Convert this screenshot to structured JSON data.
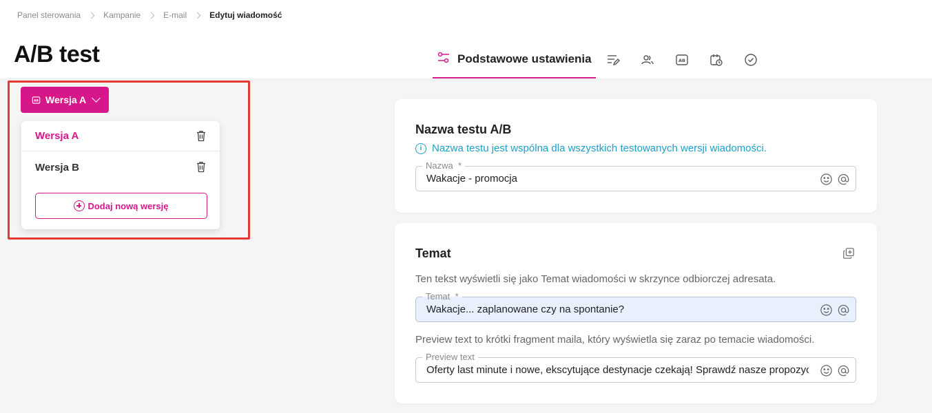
{
  "breadcrumb": {
    "items": [
      "Panel sterowania",
      "Kampanie",
      "E-mail"
    ],
    "current": "Edytuj wiadomość"
  },
  "page_title": "A/B test",
  "tabs": {
    "active_label": "Podstawowe ustawienia",
    "icons": [
      "content-edit-icon",
      "recipients-icon",
      "ab-test-icon",
      "schedule-icon",
      "summary-check-icon"
    ]
  },
  "version_selector": {
    "label": "Wersja A",
    "items": [
      {
        "label": "Wersja A"
      },
      {
        "label": "Wersja B"
      }
    ],
    "add_label": "Dodaj nową wersję"
  },
  "ab_name_card": {
    "title": "Nazwa testu A/B",
    "info": "Nazwa testu jest wspólna dla wszystkich testowanych wersji wiadomości.",
    "field_label": "Nazwa",
    "field_value": "Wakacje - promocja"
  },
  "subject_card": {
    "title": "Temat",
    "subject_desc": "Ten tekst wyświetli się jako Temat wiadomości w skrzynce odbiorczej adresata.",
    "subject_label": "Temat",
    "subject_value": "Wakacje... zaplanowane czy na spontanie?",
    "preview_desc": "Preview text to krótki fragment maila, który wyświetla się zaraz po temacie wiadomości.",
    "preview_label": "Preview text",
    "preview_value": "Oferty last minute i nowe, ekscytujące destynacje czekają! Sprawdź nasze propozycje"
  },
  "colors": {
    "accent": "#d6178a",
    "info": "#1ea0c8",
    "highlight": "#e53935"
  }
}
